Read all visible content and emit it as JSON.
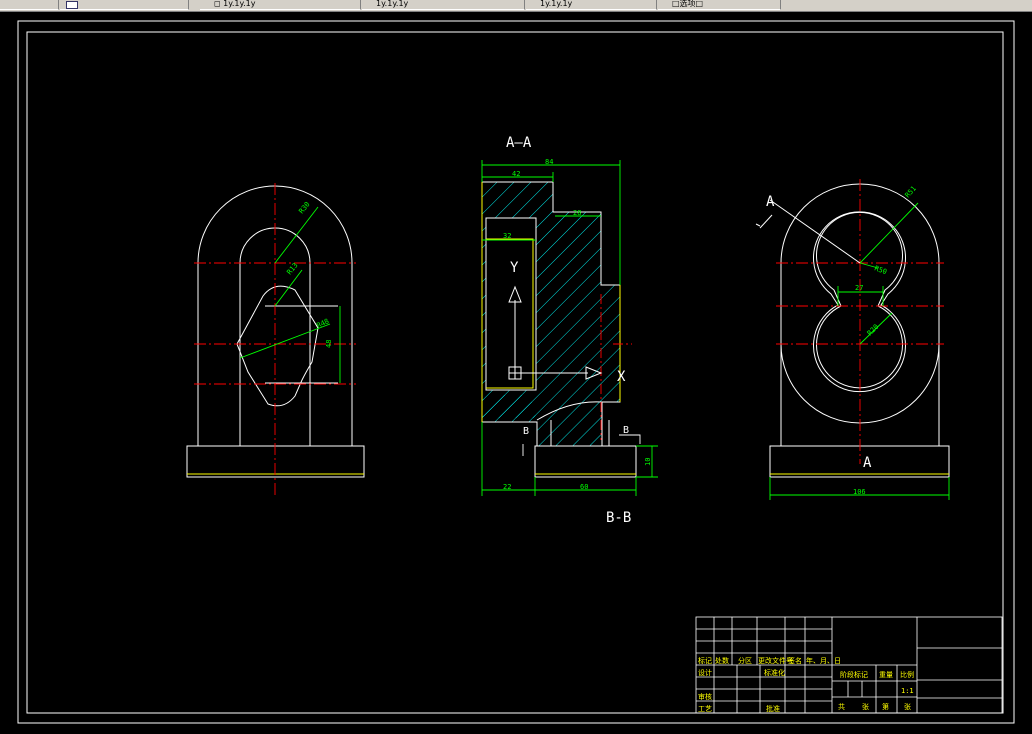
{
  "toolbar": {
    "tabs": [
      {
        "label": ""
      },
      {
        "label": ""
      },
      {
        "label": "◻ 1y.1y.1y"
      },
      {
        "label": "1y.1y.1y"
      },
      {
        "label": "1y.1y.1y"
      },
      {
        "label": "□选项□"
      }
    ]
  },
  "drawing": {
    "section_aa": "A—A",
    "section_bb": "B-B",
    "cut_a_top": "A",
    "cut_a_bottom": "A",
    "cut_b_left": "B",
    "cut_b_right": "B",
    "axis_y": "Y",
    "axis_x": "X",
    "dims_left": {
      "r_outer": "R30",
      "r_inner": "R13",
      "r_cam": "R48",
      "height": "48"
    },
    "dims_middle": {
      "overall": "84",
      "top_left": "42",
      "step": "28",
      "inner": "32",
      "base_left": "22",
      "base_right": "60",
      "base_h": "10"
    },
    "dims_right": {
      "r_outer": "R51",
      "r_upper": "R50",
      "gap": "27",
      "r_lower": "R20",
      "width": "106"
    }
  },
  "title_block": {
    "labels": {
      "mark": "标记",
      "count": "处数",
      "zone": "分区",
      "change_doc": "更改文件号",
      "signature": "签名",
      "date": "年、月、日",
      "design": "设计",
      "standard": "标准化",
      "stage_mark": "阶段标记",
      "weight": "重量",
      "scale": "比例",
      "review": "审核",
      "process": "工艺",
      "approve": "批准",
      "total": "共",
      "sheet": "张",
      "no": "第",
      "sheet2": "张"
    },
    "scale_value": "1:1"
  },
  "colors": {
    "background": "#000000",
    "outline": "#ffffff",
    "centerline": "#ff0000",
    "dimension": "#00ff00",
    "hatch": "#00ffff",
    "yellow": "#ffff00"
  }
}
